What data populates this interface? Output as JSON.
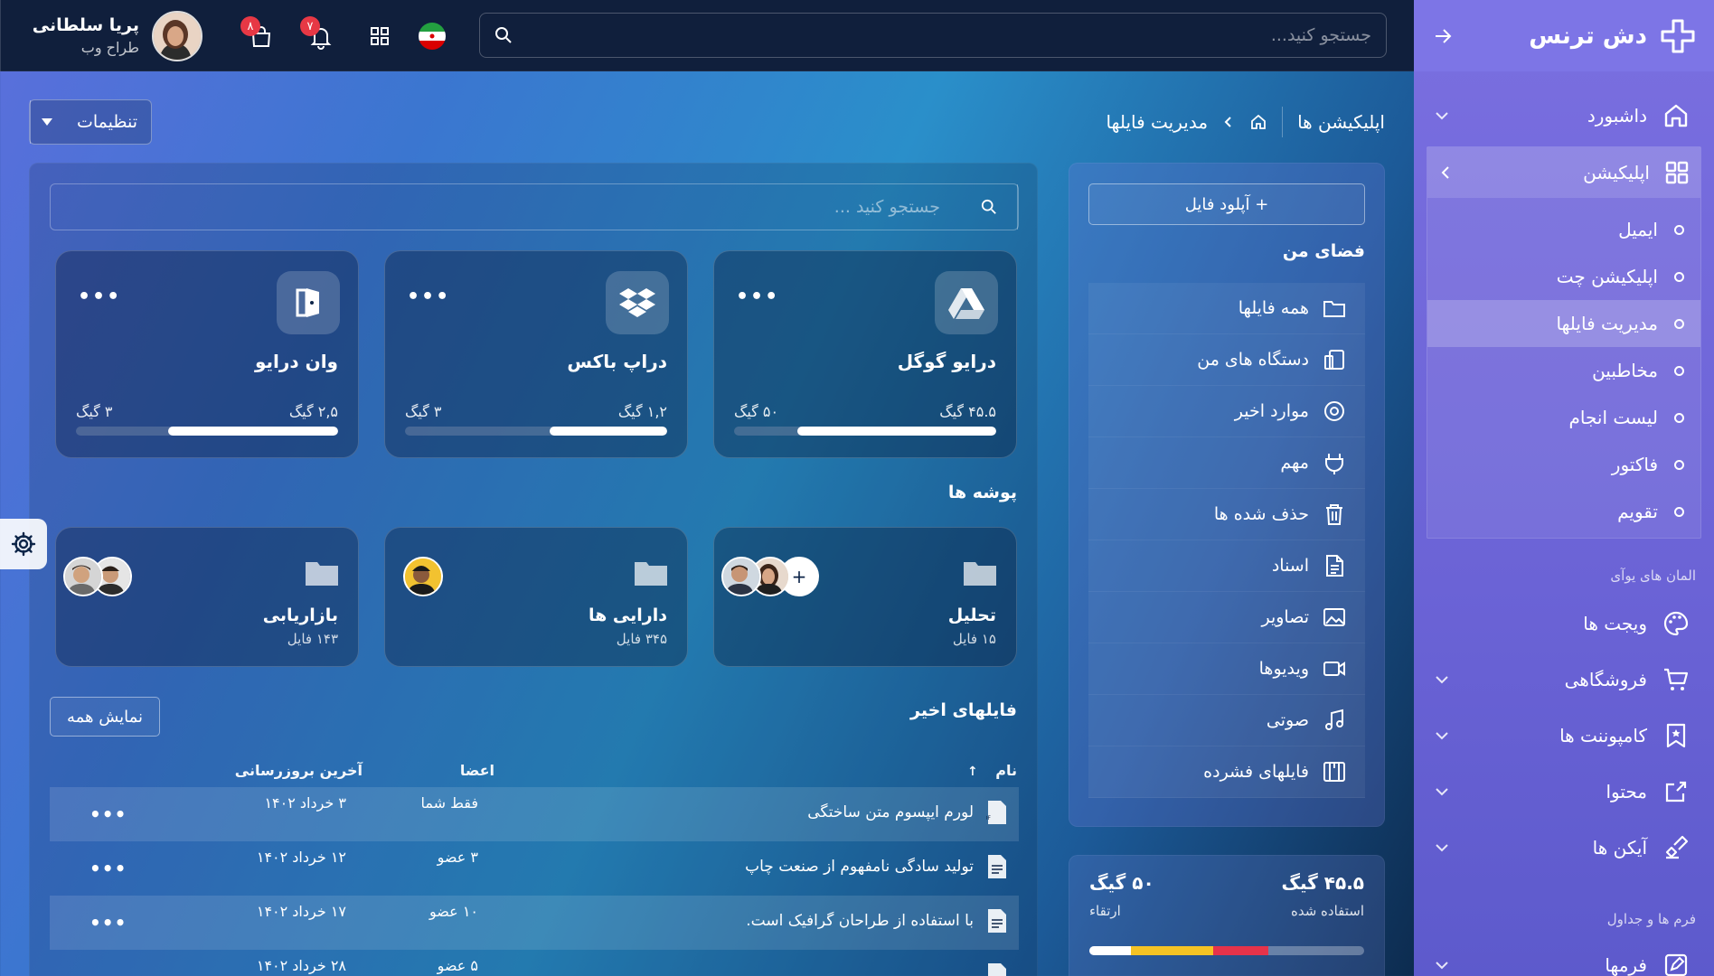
{
  "brand": {
    "name": "دش ترنس"
  },
  "topbar": {
    "search_placeholder": "جستجو کنید...",
    "cart_badge": "۸",
    "bell_badge": "۷",
    "user_name": "پریا سلطانی",
    "user_role": "طراح وب"
  },
  "breadcrumb": {
    "apps": "اپلیکیشن ها",
    "current": "مدیریت فایلها"
  },
  "settings_label": "تنظیمات",
  "sidebar": {
    "dashboard": "داشبورد",
    "apps": "اپلیکیشن",
    "sub": [
      "ایمیل",
      "اپلیکیشن چت",
      "مدیریت فایلها",
      "مخاطبین",
      "لیست انجام",
      "فاکتور",
      "تقویم"
    ],
    "ui_section": "المان های یوآی",
    "ui_items": [
      "ویجت ها",
      "فروشگاهی",
      "کامپوننت ها",
      "محتوا",
      "آیکن ها"
    ],
    "forms_section": "فرم ها و جداول",
    "forms_item": "فرمها"
  },
  "filemenu": {
    "upload": "+ آپلود فایل",
    "myspace": "فضای من",
    "items": [
      "همه فایلها",
      "دستگاه های من",
      "موارد اخیر",
      "مهم",
      "حذف شده ها",
      "اسناد",
      "تصاویر",
      "ویدیوها",
      "صوتی",
      "فایلهای فشرده"
    ]
  },
  "storage": {
    "used": "۴۵.۵ گیگ",
    "used_label": "استفاده شده",
    "total": "۵۰ گیگ",
    "upgrade": "ارتقاء"
  },
  "main": {
    "search_placeholder": "جستجو کنید ...",
    "drives": [
      {
        "name": "درایو گوگل",
        "used": "۴۵.۵ گیگ",
        "total": "۵۰ گیگ",
        "ratio": 0.76
      },
      {
        "name": "دراپ باکس",
        "used": "۱,۲ گیگ",
        "total": "۳ گیگ",
        "ratio": 0.45
      },
      {
        "name": "وان درایو",
        "used": "۲,۵ گیگ",
        "total": "۳ گیگ",
        "ratio": 0.65
      }
    ],
    "folders_title": "پوشه ها",
    "folders": [
      {
        "name": "تحلیل",
        "count": "۱۵ فایل"
      },
      {
        "name": "دارایی ها",
        "count": "۳۴۵ فایل"
      },
      {
        "name": "بازاریابی",
        "count": "۱۴۳ فایل"
      }
    ],
    "recent_title": "فایلهای اخیر",
    "show_all": "نمایش همه",
    "columns": {
      "name": "نام",
      "members": "اعضا",
      "updated": "آخرین بروزرسانی"
    },
    "rows": [
      {
        "name": "لورم ایپسوم متن ساختگی",
        "members": "فقط شما",
        "updated": "۳ خرداد ۱۴۰۲"
      },
      {
        "name": "تولید سادگی نامفهوم از صنعت چاپ",
        "members": "۳ عضو",
        "updated": "۱۲ خرداد ۱۴۰۲"
      },
      {
        "name": "با استفاده از طراحان گرافیک است.",
        "members": "۱۰ عضو",
        "updated": "۱۷ خرداد ۱۴۰۲"
      },
      {
        "name": "",
        "members": "۵ عضو",
        "updated": "۲۸ خرداد ۱۴۰۲"
      }
    ]
  }
}
